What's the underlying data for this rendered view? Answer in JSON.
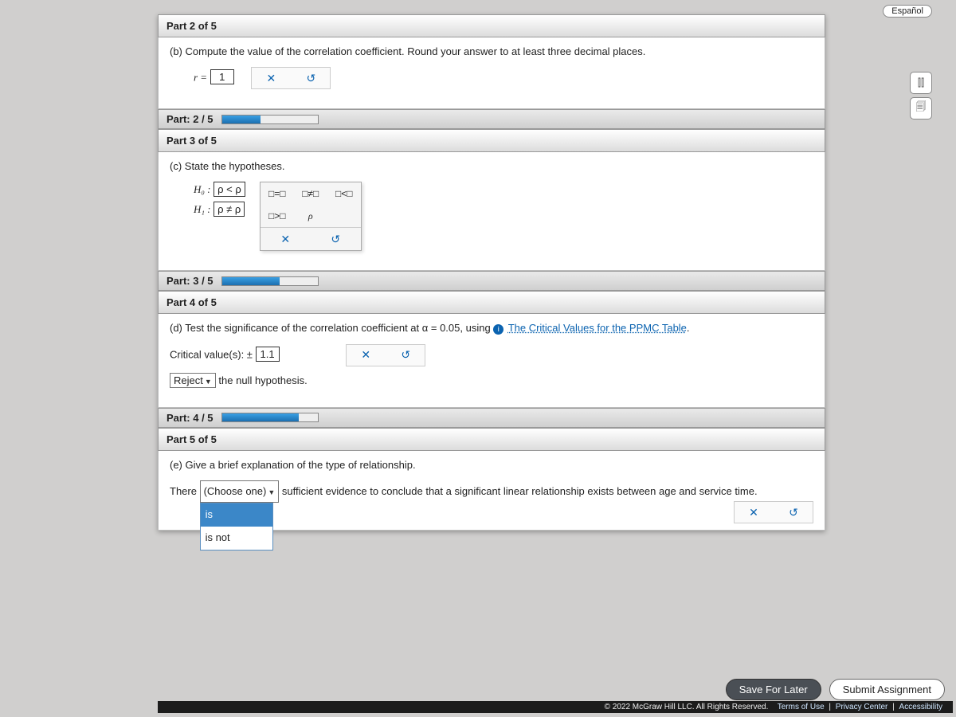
{
  "lang_btn": "Español",
  "side": {
    "a": "⫿⫿",
    "b": "🗐"
  },
  "part2": {
    "header": "Part 2 of 5",
    "prompt": "(b) Compute the value of the correlation coefficient. Round your answer to at least three decimal places.",
    "r_label": "r =",
    "r_value": "1",
    "clear": "✕",
    "reset": "↺"
  },
  "prog2": {
    "label": "Part: 2 / 5",
    "pct": 40
  },
  "part3": {
    "header": "Part 3 of 5",
    "prompt": "(c) State the hypotheses.",
    "h0_label": "H₀ :",
    "h0_val": "ρ < ρ",
    "h1_label": "H₁ :",
    "h1_val": "ρ ≠ ρ",
    "tiles": {
      "eq": "□=□",
      "ne": "□≠□",
      "lt": "□<□",
      "gt": "□>□",
      "rho": "ρ"
    },
    "clear": "✕",
    "reset": "↺"
  },
  "prog3": {
    "label": "Part: 3 / 5",
    "pct": 60
  },
  "part4": {
    "header": "Part 4 of 5",
    "prompt_a": "(d) Test the significance of the correlation coefficient at α = 0.05, using ",
    "link": "The Critical Values for the PPMC Table",
    "crit_label": "Critical value(s): ±",
    "crit_val": "1.1",
    "clear": "✕",
    "reset": "↺",
    "decision": "Reject",
    "decision_after": " the null hypothesis."
  },
  "prog4": {
    "label": "Part: 4 / 5",
    "pct": 80
  },
  "part5": {
    "header": "Part 5 of 5",
    "prompt": "(e) Give a brief explanation of the type of relationship.",
    "s1": "There ",
    "choose": "(Choose one)",
    "s2": " sufficient evidence to conclude that a significant linear relationship exists between age and service time.",
    "opts": {
      "a": "is",
      "b": "is not"
    },
    "clear": "✕",
    "reset": "↺"
  },
  "footer": {
    "save": "Save For Later",
    "submit": "Submit Assignment"
  },
  "copy": {
    "text": "© 2022 McGraw Hill LLC. All Rights Reserved.",
    "tou": "Terms of Use",
    "pc": "Privacy Center",
    "acc": "Accessibility"
  }
}
